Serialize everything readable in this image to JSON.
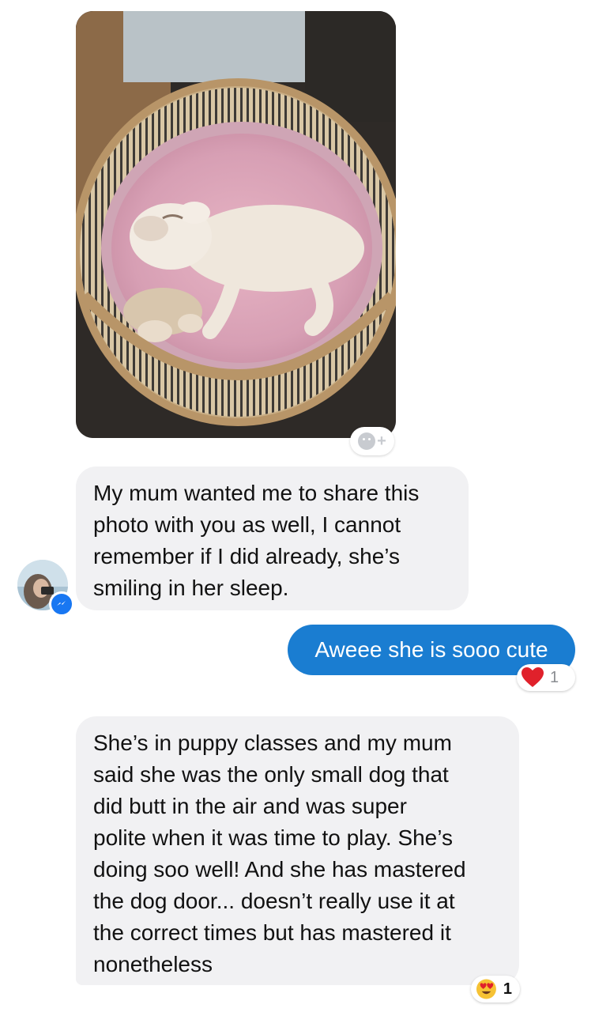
{
  "messages": {
    "msg1": "My mum wanted me to share this\nphoto with you as well, I cannot\nremember if I did already, she’s\nsmiling in her sleep.",
    "msg2": "Aweee she is sooo cute",
    "msg3": "She’s in puppy classes and my mum\nsaid she was the only small dog that\ndid butt in the air and was super\npolite when it was time to play. She’s\ndoing soo well! And she has mastered\nthe dog door... doesn’t really use it at\nthe correct times but has mastered it\nnonetheless"
  },
  "reactions": {
    "heart_count": "1",
    "love_count": "1"
  },
  "icons": {
    "add_reaction": "smiley-plus-icon",
    "heart": "red-heart-icon",
    "love": "heart-eyes-emoji-icon",
    "badge": "messenger-icon"
  },
  "colors": {
    "incoming_bubble": "#f1f1f3",
    "outgoing_bubble": "#1a7dd1",
    "heart": "#e0212b",
    "messenger": "#1877f2"
  }
}
